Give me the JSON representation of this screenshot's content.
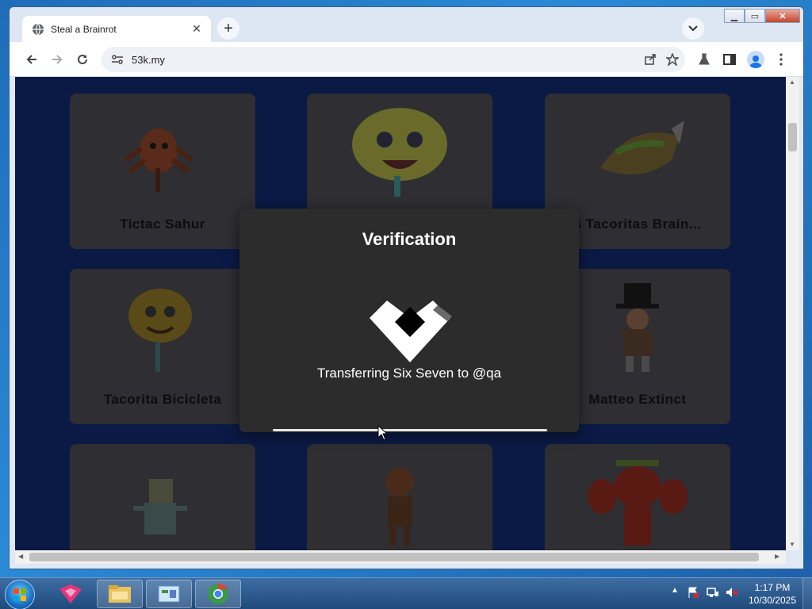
{
  "browser": {
    "tab_title": "Steal a Brainrot",
    "url": "53k.my",
    "window_controls": [
      "minimize",
      "maximize",
      "close"
    ]
  },
  "cards": [
    {
      "name": "Tictac Sahur",
      "icon": "character-red-spider"
    },
    {
      "name": "",
      "icon": "character-yellow-blob"
    },
    {
      "name": "s Tacoritas Brain...",
      "icon": "character-taco"
    },
    {
      "name": "Tacorita Bicicleta",
      "icon": "character-taco-face"
    },
    {
      "name": "Matteo Extinct",
      "icon": "character-top-hat"
    },
    {
      "name": "",
      "icon": "character-green-robot"
    },
    {
      "name": "",
      "icon": "character-brown-monkey"
    },
    {
      "name": "",
      "icon": "character-red-muscle"
    }
  ],
  "modal": {
    "title": "Verification",
    "status": "Transferring Six Seven to @qa",
    "progress": 1.0
  },
  "taskbar": {
    "time": "1:17 PM",
    "date": "10/30/2025",
    "items": [
      "start-orb",
      "kaspersky-icon",
      "file-explorer-icon",
      "control-panel-icon",
      "chrome-icon"
    ]
  },
  "colors": {
    "page_background": "#0b1a45",
    "card_background": "#2e2e33",
    "modal_background": "#2c2c2c"
  }
}
